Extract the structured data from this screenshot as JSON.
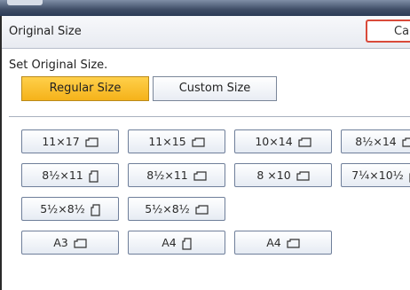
{
  "dialog": {
    "title": "Original Size",
    "cancel_label": "Can",
    "prompt": "Set Original Size."
  },
  "tabs": {
    "regular": "Regular Size",
    "custom": "Custom Size"
  },
  "sizes": {
    "r1": [
      "11×17",
      "11×15",
      "10×14",
      "8½×14"
    ],
    "r2": [
      "8½×11",
      "8½×11",
      "8 ×10",
      "7¼×10½"
    ],
    "r3": [
      "5½×8½",
      "5½×8½"
    ],
    "r4": [
      "A3",
      "A4",
      "A4"
    ]
  },
  "icons": {
    "landscape": "landscape-orientation-icon",
    "portrait": "portrait-orientation-icon"
  },
  "colors": {
    "active_tab": "#f5b21a",
    "cancel_border": "#d94a3a"
  }
}
